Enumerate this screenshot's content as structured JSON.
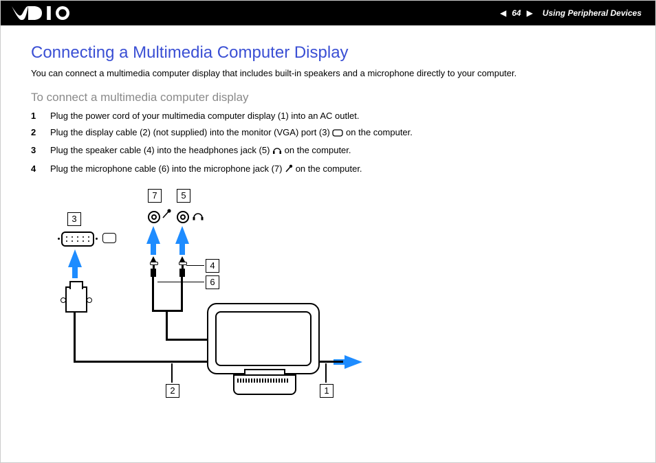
{
  "header": {
    "page_number": "64",
    "section": "Using Peripheral Devices"
  },
  "title": "Connecting a Multimedia Computer Display",
  "intro": "You can connect a multimedia computer display that includes built-in speakers and a microphone directly to your computer.",
  "subtitle": "To connect a multimedia computer display",
  "steps": [
    {
      "n": "1",
      "before": "Plug the power cord of your multimedia computer display (1) into an AC outlet.",
      "after": ""
    },
    {
      "n": "2",
      "before": "Plug the display cable (2) (not supplied) into the monitor (VGA) port (3) ",
      "after": " on the computer."
    },
    {
      "n": "3",
      "before": "Plug the speaker cable (4) into the headphones jack (5) ",
      "after": " on the computer."
    },
    {
      "n": "4",
      "before": "Plug the microphone cable (6) into the microphone jack (7) ",
      "after": " on the computer."
    }
  ],
  "diagram": {
    "callouts": {
      "c1": "1",
      "c2": "2",
      "c3": "3",
      "c4": "4",
      "c5": "5",
      "c6": "6",
      "c7": "7"
    }
  }
}
